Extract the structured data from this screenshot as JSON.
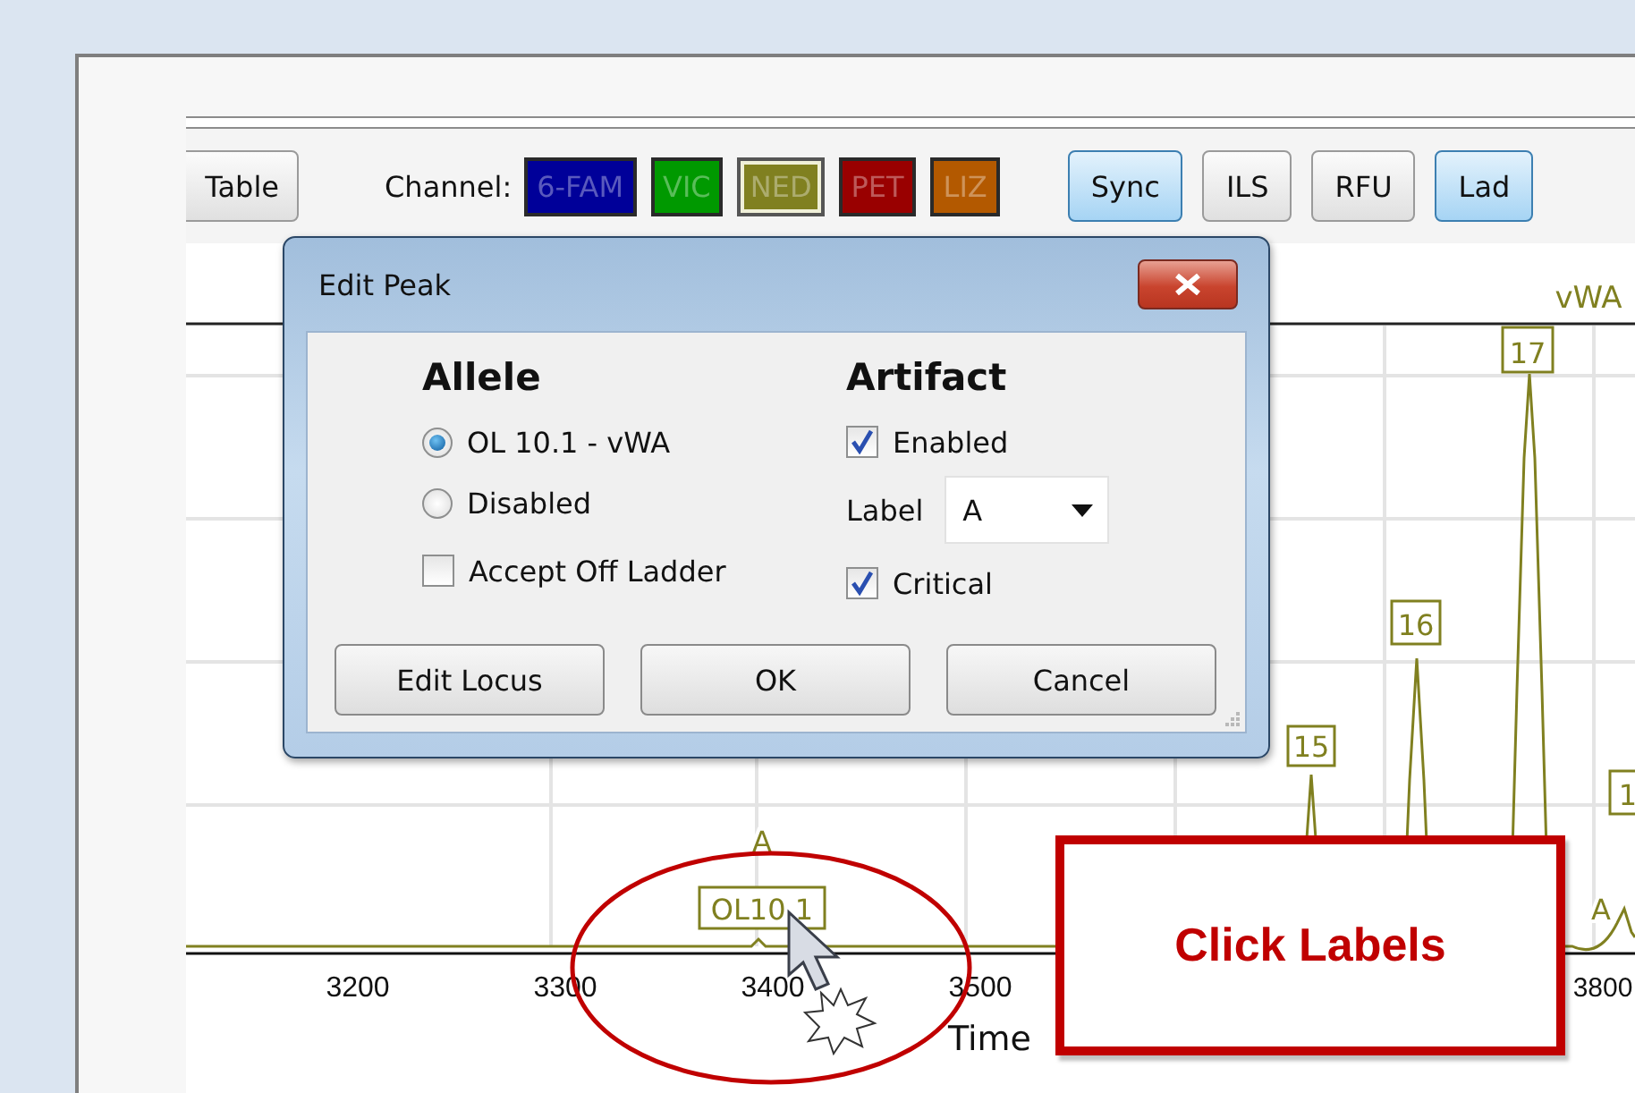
{
  "toolbar": {
    "table_button": "Table",
    "channel_label": "Channel:",
    "channels": [
      {
        "label": "6-FAM",
        "color": "#000099",
        "selected": false
      },
      {
        "label": "VIC",
        "color": "#009900",
        "selected": false
      },
      {
        "label": "NED",
        "color": "#808020",
        "selected": true
      },
      {
        "label": "PET",
        "color": "#990000",
        "selected": false
      },
      {
        "label": "LIZ",
        "color": "#b35900",
        "selected": false
      }
    ],
    "buttons": [
      {
        "label": "Sync",
        "toggled": true
      },
      {
        "label": "ILS",
        "toggled": false
      },
      {
        "label": "RFU",
        "toggled": false
      },
      {
        "label": "Lad",
        "toggled": true
      }
    ]
  },
  "dialog": {
    "title": "Edit Peak",
    "allele": {
      "heading": "Allele",
      "options": [
        {
          "label": "OL 10.1 - vWA",
          "selected": true
        },
        {
          "label": "Disabled",
          "selected": false
        }
      ],
      "accept_off_ladder": {
        "label": "Accept Off Ladder",
        "checked": false
      }
    },
    "artifact": {
      "heading": "Artifact",
      "enabled": {
        "label": "Enabled",
        "checked": true
      },
      "label_field": {
        "label": "Label",
        "value": "A"
      },
      "critical": {
        "label": "Critical",
        "checked": true
      }
    },
    "buttons": [
      "Edit Locus",
      "OK",
      "Cancel"
    ]
  },
  "plot": {
    "locus": "vWA",
    "peak_labels": [
      {
        "text": "15"
      },
      {
        "text": "16"
      },
      {
        "text": "17"
      },
      {
        "text": "1"
      }
    ],
    "artifact_labels": [
      {
        "text": "A"
      },
      {
        "text": "A"
      }
    ],
    "off_ladder_label": "OL10.1",
    "x_ticks": [
      "3200",
      "3300",
      "3400",
      "3500",
      "3800"
    ],
    "x_axis_label": "Time"
  },
  "callout": {
    "text": "Click Labels"
  }
}
